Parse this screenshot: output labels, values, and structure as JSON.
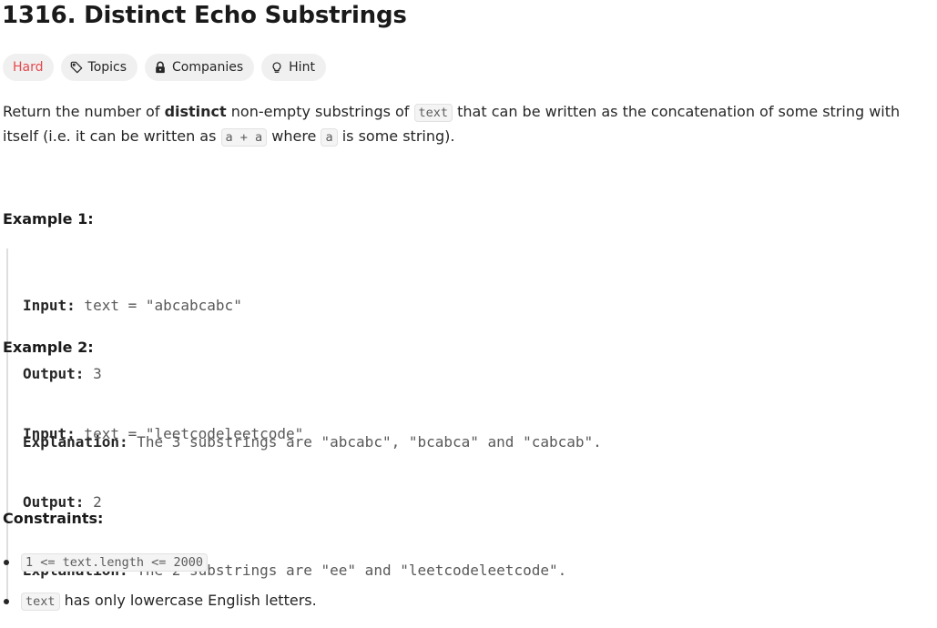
{
  "problem": {
    "title": "1316. Distinct Echo Substrings",
    "difficulty": "Hard",
    "tags": {
      "topics": "Topics",
      "companies": "Companies",
      "hint": "Hint"
    },
    "colors": {
      "difficulty_hard": "#e5484d",
      "tag_bg": "#f0f0f0"
    }
  },
  "description": {
    "p1": "Return the number of ",
    "p1_bold": "distinct",
    "p2": " non-empty substrings of ",
    "code_text": "text",
    "p3": " that can be written as the concatenation of some string with itself (i.e. it can be written as ",
    "code_a_plus_a": "a + a",
    "p4": " where ",
    "code_a": "a",
    "p5": " is some string)."
  },
  "examples": [
    {
      "heading": "Example 1:",
      "input_label": "Input:",
      "input_value": " text = \"abcabcabc\"",
      "output_label": "Output:",
      "output_value": " 3",
      "explanation_label": "Explanation:",
      "explanation_value": " The 3 substrings are \"abcabc\", \"bcabca\" and \"cabcab\"."
    },
    {
      "heading": "Example 2:",
      "input_label": "Input:",
      "input_value": " text = \"leetcodeleetcode\"",
      "output_label": "Output:",
      "output_value": " 2",
      "explanation_label": "Explanation:",
      "explanation_value": " The 2 substrings are \"ee\" and \"leetcodeleetcode\"."
    }
  ],
  "constraints": {
    "heading": "Constraints:",
    "c1_code": "1 <= text.length <= 2000",
    "c2_code": "text",
    "c2_text": " has only lowercase English letters."
  },
  "icons": [
    "tag-icon",
    "lock-icon",
    "lightbulb-icon"
  ]
}
